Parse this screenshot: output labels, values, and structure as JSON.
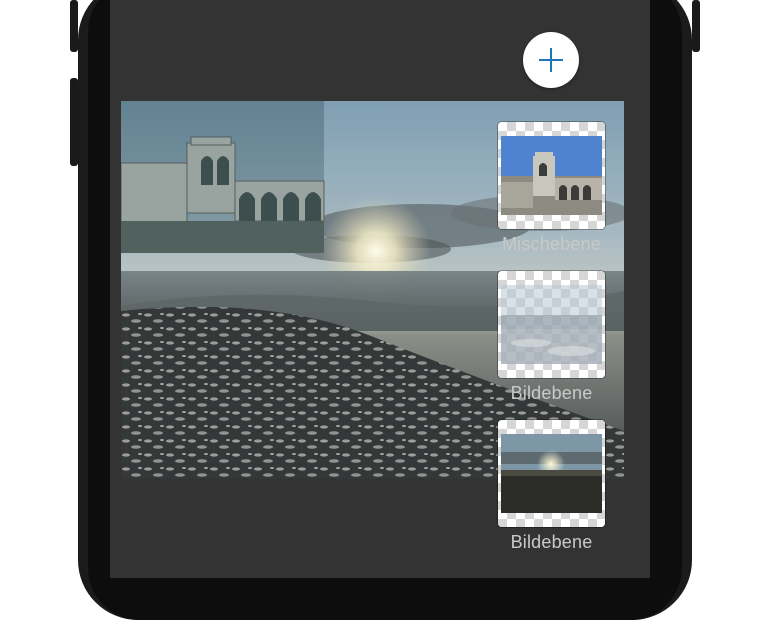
{
  "toolbar": {
    "add_button_icon": "plus-icon",
    "accent_color": "#1f78b4"
  },
  "canvas": {
    "description_icon": "composite-image"
  },
  "layers": [
    {
      "label": "Mischebene",
      "thumbnail": "building-photo"
    },
    {
      "label": "Bildebene",
      "thumbnail": "transparent-sea-photo"
    },
    {
      "label": "Bildebene",
      "thumbnail": "sunset-photo"
    }
  ]
}
